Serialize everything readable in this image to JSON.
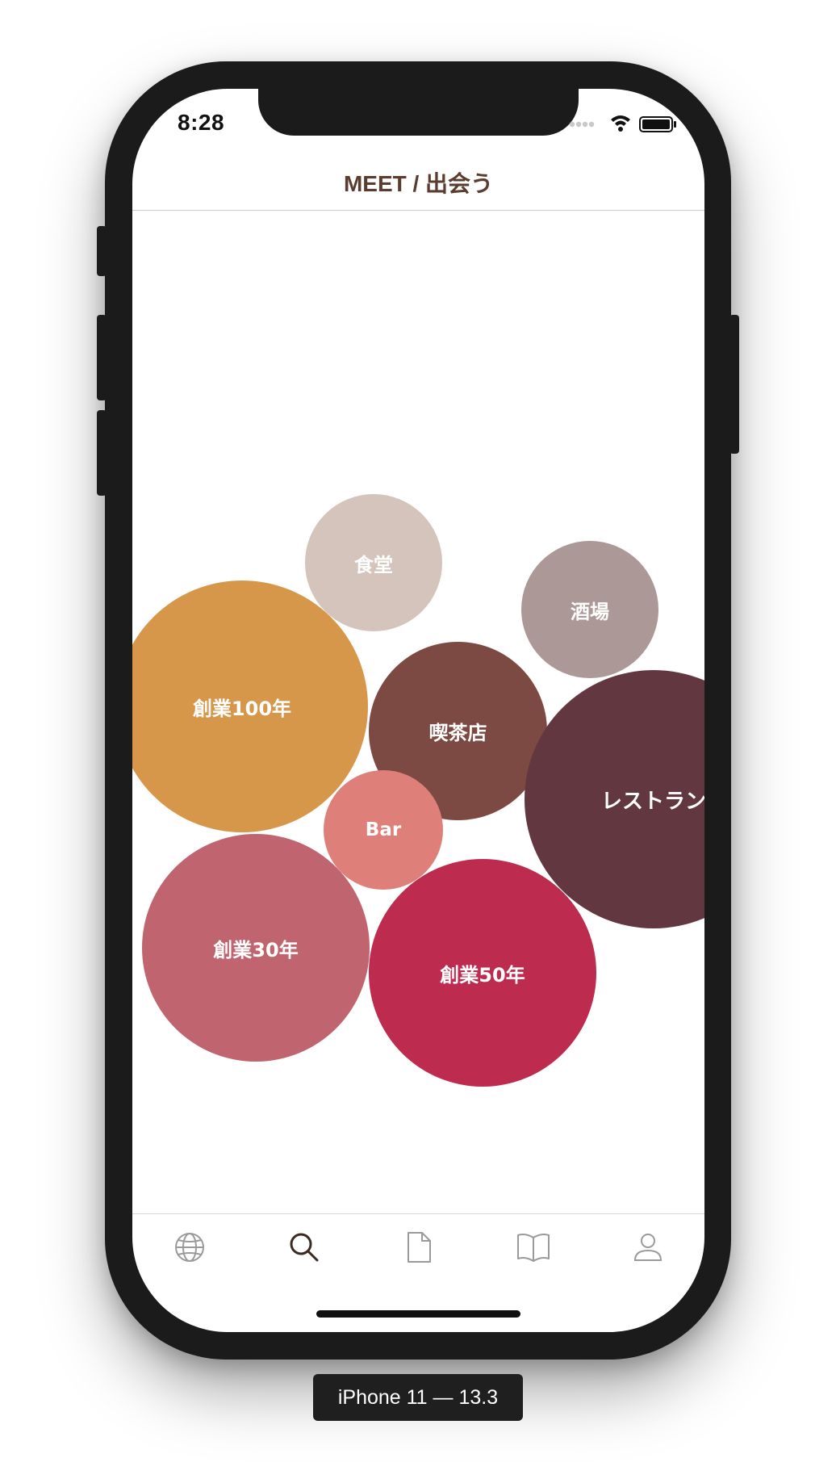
{
  "status_bar": {
    "time": "8:28",
    "signal_icon": "signal-dots-icon",
    "wifi_icon": "wifi-icon",
    "battery_icon": "battery-icon"
  },
  "nav": {
    "title": "MEET / 出会う"
  },
  "bubbles": [
    {
      "label": "食堂",
      "color": "#d4c4bb"
    },
    {
      "label": "酒場",
      "color": "#ac9896"
    },
    {
      "label": "喫茶店",
      "color": "#7d4a43"
    },
    {
      "label": "創業100年",
      "color": "#d6974b"
    },
    {
      "label": "レストラン",
      "color": "#62373f"
    },
    {
      "label": "Bar",
      "color": "#df7f79"
    },
    {
      "label": "創業30年",
      "color": "#c0646f"
    },
    {
      "label": "創業50年",
      "color": "#bd2c4f"
    }
  ],
  "tabs": [
    {
      "name": "globe-icon",
      "selected": false
    },
    {
      "name": "search-icon",
      "selected": true
    },
    {
      "name": "document-icon",
      "selected": false
    },
    {
      "name": "book-icon",
      "selected": false
    },
    {
      "name": "person-icon",
      "selected": false
    }
  ],
  "colors": {
    "nav_title": "#5a3d2e",
    "tab_selected": "#3a2a22",
    "tab_unselected": "#9a9a9a"
  },
  "simulator_label": "iPhone 11 — 13.3"
}
